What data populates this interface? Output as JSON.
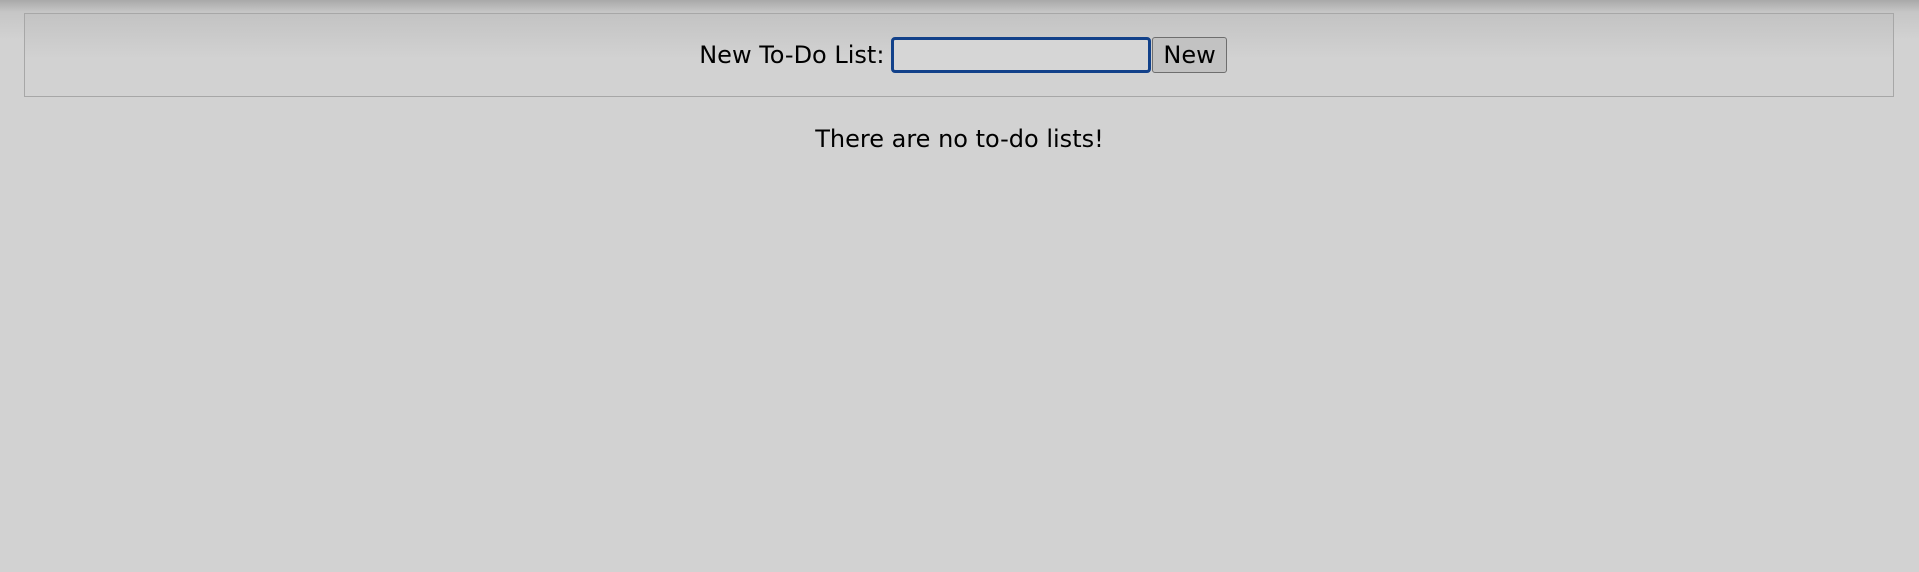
{
  "form": {
    "label": "New To-Do List:",
    "input_value": "",
    "input_placeholder": "",
    "button_label": "New"
  },
  "main": {
    "empty_message": "There are no to-do lists!"
  },
  "colors": {
    "background": "#d2d2d2",
    "focus_border": "#12418a",
    "button_background": "#c2c2c2"
  }
}
